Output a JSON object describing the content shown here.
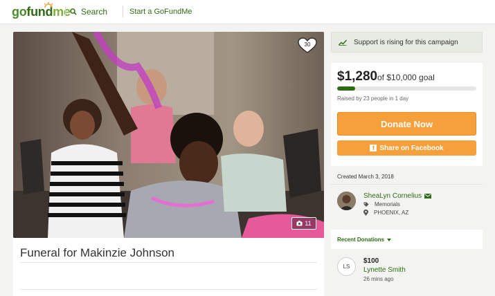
{
  "header": {
    "logo": {
      "go": "go",
      "fund": "fund",
      "me": "me"
    },
    "search_label": "Search",
    "start_label": "Start a GoFundMe"
  },
  "hero": {
    "heart_count": "30",
    "photo_count": "11"
  },
  "campaign": {
    "title": "Funeral for Makinzie Johnson"
  },
  "sidebar": {
    "rising_text": "Support is rising for this campaign",
    "raised_amount": "$1,280",
    "goal_text": "of $10,000 goal",
    "progress_fraction": 0.128,
    "raised_by": "Raised by 23 people in 1 day",
    "donate_label": "Donate Now",
    "share_label": "Share on Facebook",
    "fb_glyph": "f",
    "created": "Created March 3, 2018",
    "organizer": {
      "name": "SheaLyn Cornelius",
      "category": "Memorials",
      "location": "PHOENIX, AZ"
    },
    "recent_label": "Recent Donations",
    "donations": [
      {
        "initials": "LS",
        "amount": "$100",
        "name": "Lynette Smith",
        "time": "26 mins ago"
      }
    ]
  },
  "colors": {
    "brand_green": "#2f6b14",
    "accent_orange": "#f5a03a",
    "page_bg": "#f3f3f1"
  }
}
